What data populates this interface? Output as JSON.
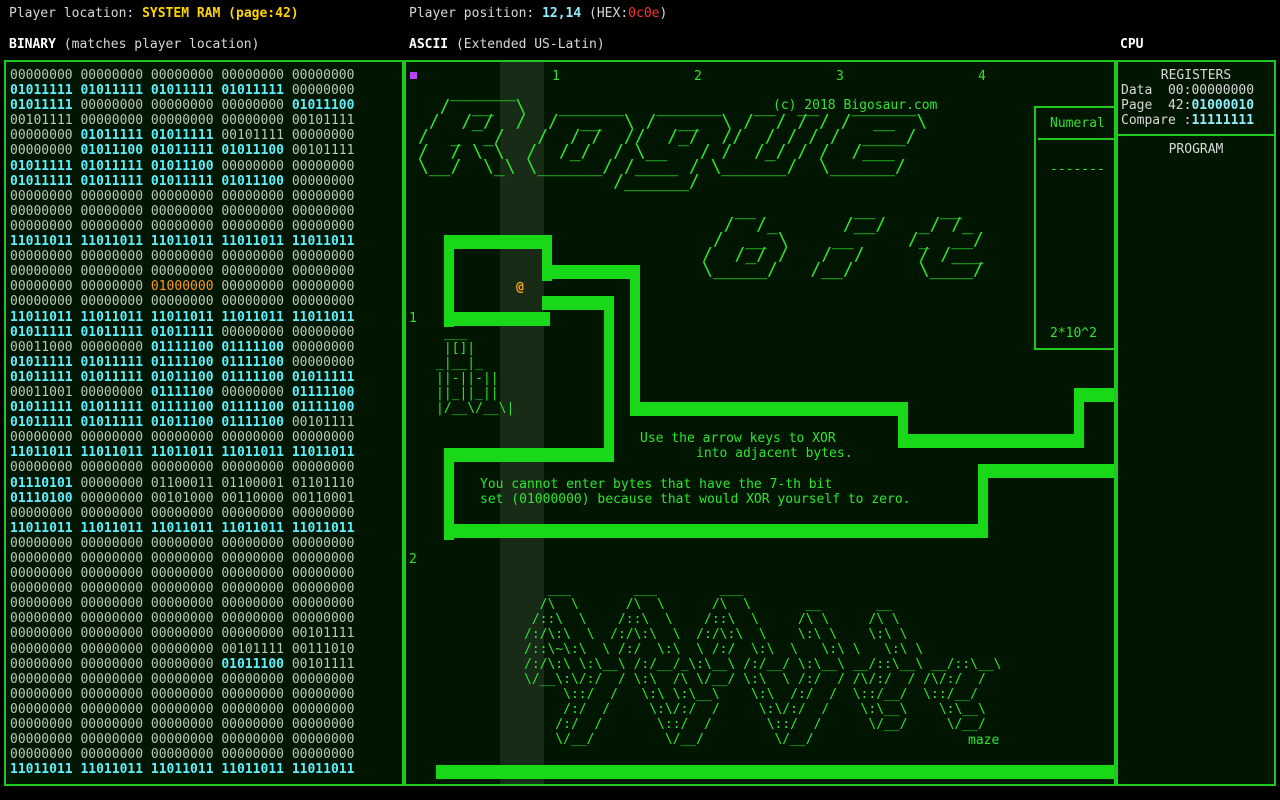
{
  "header": {
    "location_label": "Player location:",
    "location_value": "SYSTEM RAM",
    "page_label": "(page:",
    "page_value": "42",
    "page_close": ")",
    "position_label": "Player position:",
    "position_value": "12,14",
    "hex_label": "(HEX:",
    "hex_value": "0c0e",
    "hex_close": ")"
  },
  "sections": {
    "binary_title": "BINARY",
    "binary_sub": "(matches player location)",
    "ascii_title": "ASCII",
    "ascii_sub": "(Extended US-Latin)",
    "cpu_title": "CPU"
  },
  "binary_rows": [
    "00000000 00000000 00000000 00000000 00000000",
    "01011111 01011111 01011111 01011111 00000000",
    "01011111 00000000 00000000 00000000 01011100",
    "00101111 00000000 00000000 00000000 00101111",
    "00000000 01011111 01011111 00101111 00000000",
    "00000000 01011100 01011111 01011100 00101111",
    "01011111 01011111 01011100 00000000 00000000",
    "01011111 01011111 01011111 01011100 00000000",
    "00000000 00000000 00000000 00000000 00000000",
    "00000000 00000000 00000000 00000000 00000000",
    "00000000 00000000 00000000 00000000 00000000",
    "11011011 11011011 11011011 11011011 11011011",
    "00000000 00000000 00000000 00000000 00000000",
    "00000000 00000000 00000000 00000000 00000000",
    "00000000 00000000 01000000 00000000 00000000",
    "00000000 00000000 00000000 00000000 00000000",
    "11011011 11011011 11011011 11011011 11011011",
    "01011111 01011111 01011111 00000000 00000000",
    "00011000 00000000 01111100 01111100 00000000",
    "01011111 01011111 01111100 01111100 00000000",
    "01011111 01011111 01011100 01111100 01011111",
    "00011001 00000000 01111100 00000000 01111100",
    "01011111 01011111 01111100 01111100 01111100",
    "01011111 01011111 01011100 01111100 00101111",
    "00000000 00000000 00000000 00000000 00000000",
    "11011011 11011011 11011011 11011011 11011011",
    "00000000 00000000 00000000 00000000 00000000",
    "01110101 00000000 01100011 01100001 01101110",
    "01110100 00000000 00101000 00110000 00110001",
    "00000000 00000000 00000000 00000000 00000000",
    "11011011 11011011 11011011 11011011 11011011",
    "00000000 00000000 00000000 00000000 00000000",
    "00000000 00000000 00000000 00000000 00000000",
    "00000000 00000000 00000000 00000000 00000000",
    "00000000 00000000 00000000 00000000 00000000",
    "00000000 00000000 00000000 00000000 00000000",
    "00000000 00000000 00000000 00000000 00000000",
    "00000000 00000000 00000000 00000000 00101111",
    "00000000 00000000 00000000 00101111 00111010",
    "00000000 00000000 00000000 01011100 00101111",
    "00000000 00000000 00000000 00000000 00000000",
    "00000000 00000000 00000000 00000000 00000000",
    "00000000 00000000 00000000 00000000 00000000",
    "00000000 00000000 00000000 00000000 00000000",
    "00000000 00000000 00000000 00000000 00000000",
    "00000000 00000000 00000000 00000000 00000000",
    "11011011 11011011 11011011 11011011 11011011"
  ],
  "ascii_view": {
    "column_markers": [
      "1",
      "2",
      "3",
      "4"
    ],
    "row_markers": [
      "1",
      "2"
    ],
    "copyright": "(c) 2018 Bigosaur.com",
    "title_art": "   ______\n  /  __  \\   ______   ______   __  __   ______\n /  /_/  /  /  __  \\ /  __  \\ /  / / / /  __  \\\n/  _  _/   /  / /  //  /_/  //  / / / /  ____/\n/  / \\ \\  /  /_/  / \\__   / /  /_/ / /  /___\n\\__/  \\_\\ \\______/ /____ / \\______/  \\______/\n                  /______/",
    "bit_art": "   __         __      __\n  /  /_      /__/   _/ /_\n /  __ \\    __     /_  __/\n/  /_/ /   /  /     / /___\n\\_____/   /__/      \\____/",
    "key_art": " ___\n |[]|\n_|__|_\n||-||-||\n||_||_||\n|/__\\/__\\|",
    "maze_art": "   ___        ___        ___\n  /\\  \\      /\\  \\      /\\  \\       __       __\n /::\\  \\    /::\\  \\    /::\\  \\     /\\ \\     /\\ \\\n/:/\\:\\  \\  /:/\\:\\  \\  /:/\\:\\  \\    \\:\\ \\    \\:\\ \\\n/::\\~\\:\\  \\ /:/  \\:\\  \\ /:/  \\:\\  \\   \\:\\ \\   \\:\\ \\\n/:/\\:\\ \\:\\__\\ /:/__/_\\:\\__\\ /:/__/ \\:\\__\\ __/::\\__\\ __/::\\__\\\n\\/__\\:\\/:/  / \\:\\  /\\ \\/__/ \\:\\  \\ /:/  / /\\/:/  / /\\/:/  /\n     \\::/  /   \\:\\ \\:\\__\\    \\:\\  /:/  /  \\::/__/  \\::/__/\n     /:/  /     \\:\\/:/  /     \\:\\/:/  /    \\:\\__\\    \\:\\__\\\n    /:/  /       \\::/  /       \\::/  /      \\/__/     \\/__/\n    \\/__/         \\/__/         \\/__/",
    "instruction1_line1": "Use the arrow keys to XOR",
    "instruction1_line2": "into adjacent bytes.",
    "instruction2_line1": "You cannot enter bytes that have the 7-th bit",
    "instruction2_line2": "set (01000000) because that would XOR yourself to zero.",
    "numeral_label": "Numeral",
    "numeral_dashes": "-------",
    "numeral_value": "2*10^2",
    "maze_label": "maze",
    "player_glyph": "@"
  },
  "cpu": {
    "registers_title": "REGISTERS",
    "data_label": "Data",
    "data_prefix": "00:",
    "data_value": "00000000",
    "page_label": "Page",
    "page_prefix": "42:",
    "page_value": "01000010",
    "compare_label": "Compare",
    "compare_prefix": ":",
    "compare_value": "11111111",
    "program_title": "PROGRAM"
  },
  "colors": {
    "frame_green": "#1ec81e",
    "wall_green": "#18d818",
    "text_green": "#2fe32f",
    "highlight_cyan": "#5ff0ff",
    "player_orange": "#ffa31a",
    "location_yellow": "#ffd400",
    "hex_red": "#ff3030",
    "cursor_purple": "#c040ff"
  }
}
